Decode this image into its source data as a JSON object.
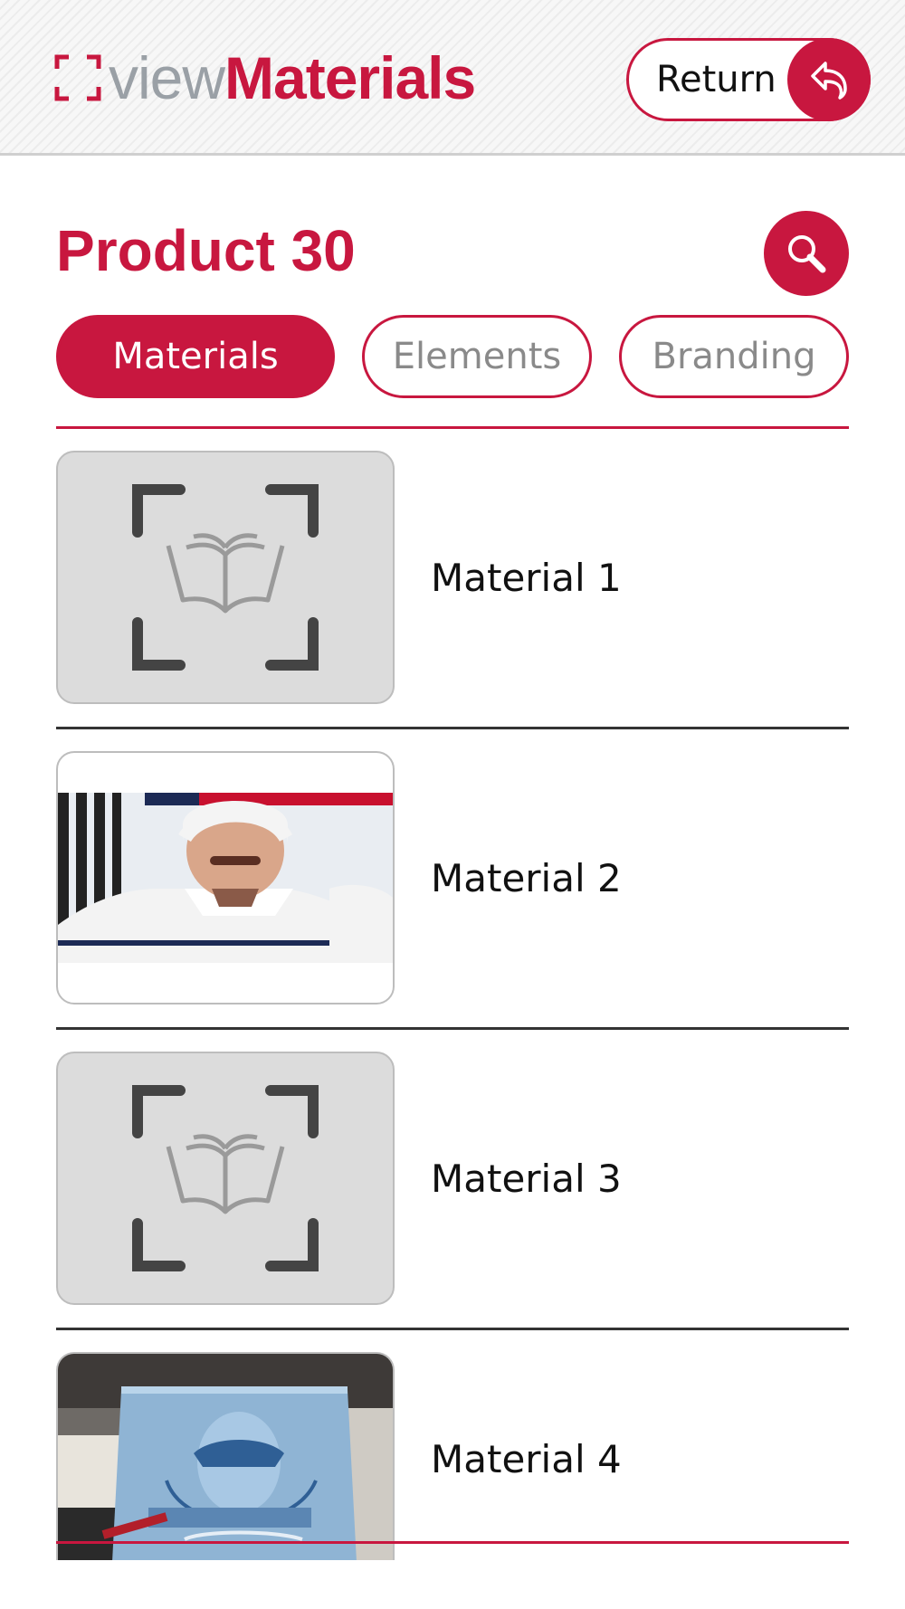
{
  "header": {
    "logo_view": "view",
    "logo_materials": "Materials",
    "return_label": "Return"
  },
  "colors": {
    "accent": "#c8173f",
    "placeholder_bg": "#dcdcdc"
  },
  "product": {
    "title": "Product 30"
  },
  "tabs": [
    {
      "label": "Materials",
      "active": true
    },
    {
      "label": "Elements",
      "active": false
    },
    {
      "label": "Branding",
      "active": false
    }
  ],
  "materials": [
    {
      "label": "Material 1",
      "thumbnail": "placeholder-book-icon"
    },
    {
      "label": "Material 2",
      "thumbnail": "photo-hockey-player"
    },
    {
      "label": "Material 3",
      "thumbnail": "placeholder-book-icon"
    },
    {
      "label": "Material 4",
      "thumbnail": "photo-glass-jar"
    }
  ]
}
